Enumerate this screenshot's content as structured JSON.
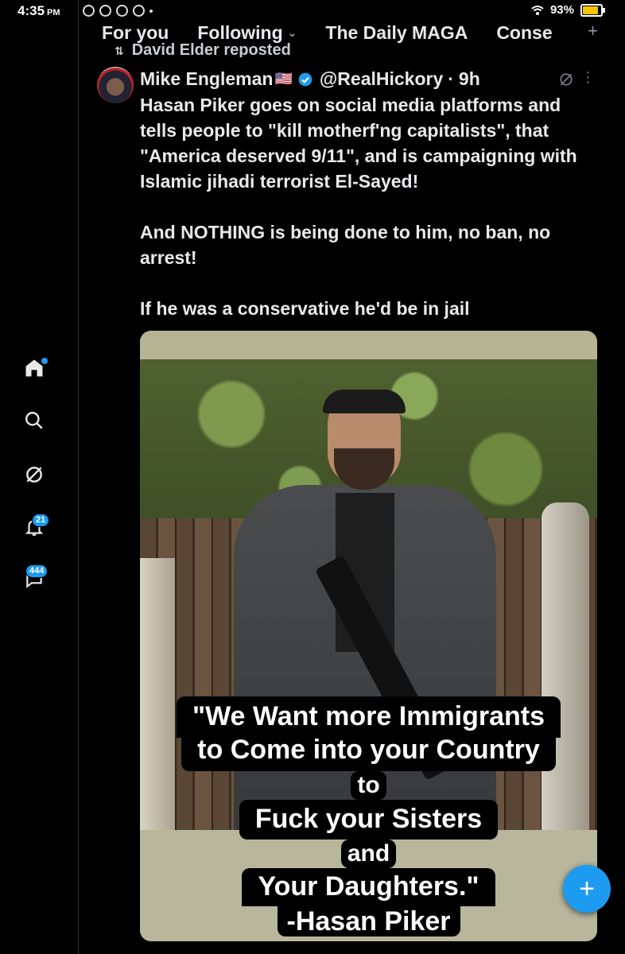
{
  "status_bar": {
    "time": "4:35",
    "ampm": "PM",
    "battery": "93%",
    "battery_level": 0.93
  },
  "tabs": [
    {
      "label": "For you"
    },
    {
      "label": "Following"
    },
    {
      "label": "The Daily MAGA"
    },
    {
      "label": "Conse"
    }
  ],
  "tabs_add": "+",
  "rail": {
    "notifications_badge": "21",
    "messages_badge": "444"
  },
  "post": {
    "repost_text": "David Elder reposted",
    "author_name": "Mike Engleman",
    "author_flag": "🇺🇸",
    "handle": "@RealHickory",
    "separator": "·",
    "time": "9h",
    "paragraphs": [
      "Hasan Piker goes on social media platforms and tells people to \"kill motherf'ng capitalists\", that \"America deserved 9/11\", and is campaigning with Islamic jihadi terrorist El-Sayed!",
      "And NOTHING is being done to him, no ban, no arrest!",
      "If he was a conservative he'd be in jail"
    ],
    "image_caption": {
      "line1": "\"We Want more Immigrants",
      "line2": "to Come into your Country",
      "line3": "to",
      "line4": "Fuck your Sisters",
      "line5": "and",
      "line6": "Your Daughters.\"",
      "line7": "-Hasan Piker"
    }
  },
  "fab": {
    "label": "+",
    "color": "#1d9bf0"
  },
  "colors": {
    "background": "#000000",
    "text": "#e7e9ea",
    "accent": "#1d9bf0"
  }
}
